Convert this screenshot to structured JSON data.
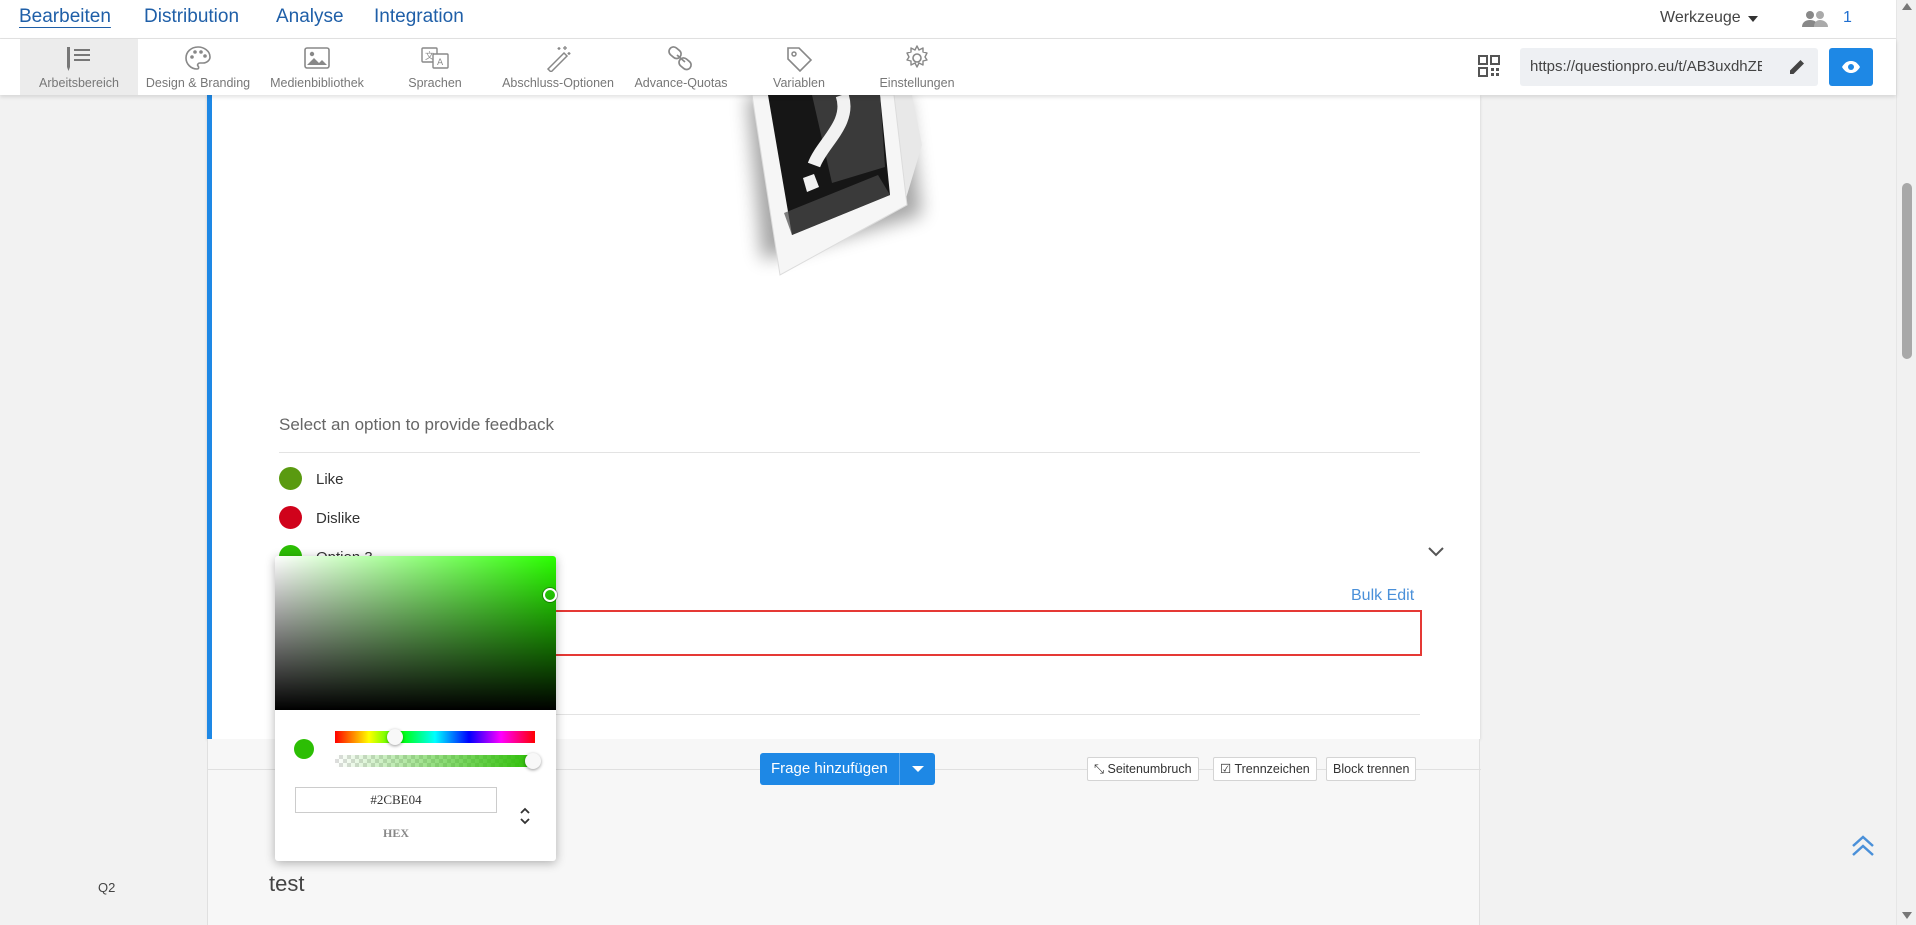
{
  "nav": {
    "tabs": [
      {
        "label": "Bearbeiten",
        "active": true
      },
      {
        "label": "Distribution"
      },
      {
        "label": "Analyse"
      },
      {
        "label": "Integration"
      }
    ],
    "tools_label": "Werkzeuge",
    "collaborators_count": "1"
  },
  "toolbar": {
    "items": [
      {
        "label": "Arbeitsbereich",
        "icon": "workspace-icon",
        "active": true
      },
      {
        "label": "Design & Branding",
        "icon": "palette-icon"
      },
      {
        "label": "Medienbibliothek",
        "icon": "image-icon"
      },
      {
        "label": "Sprachen",
        "icon": "translate-icon"
      },
      {
        "label": "Abschluss-Optionen",
        "icon": "magic-wand-icon"
      },
      {
        "label": "Advance-Quotas",
        "icon": "link-icon"
      },
      {
        "label": "Variablen",
        "icon": "tag-icon"
      },
      {
        "label": "Einstellungen",
        "icon": "gear-icon"
      }
    ],
    "url": "https://questionpro.eu/t/AB3uxdhZE"
  },
  "question": {
    "prompt": "Select an option to provide feedback",
    "options": [
      {
        "label": "Like",
        "color": "#5a9a10"
      },
      {
        "label": "Dislike",
        "color": "#d0021b"
      },
      {
        "label": "Option 3",
        "color": "#2cbe04"
      }
    ],
    "bulk_edit": "Bulk Edit"
  },
  "actions": {
    "add_question": "Frage hinzufügen",
    "page_break": "Seitenumbruch",
    "separator": "Trennzeichen",
    "split_block": "Block trennen"
  },
  "next_question": {
    "number": "Q2",
    "text": "test"
  },
  "color_picker": {
    "hex_value": "#2CBE04",
    "mode_label": "HEX",
    "color": "#2cbe04"
  }
}
